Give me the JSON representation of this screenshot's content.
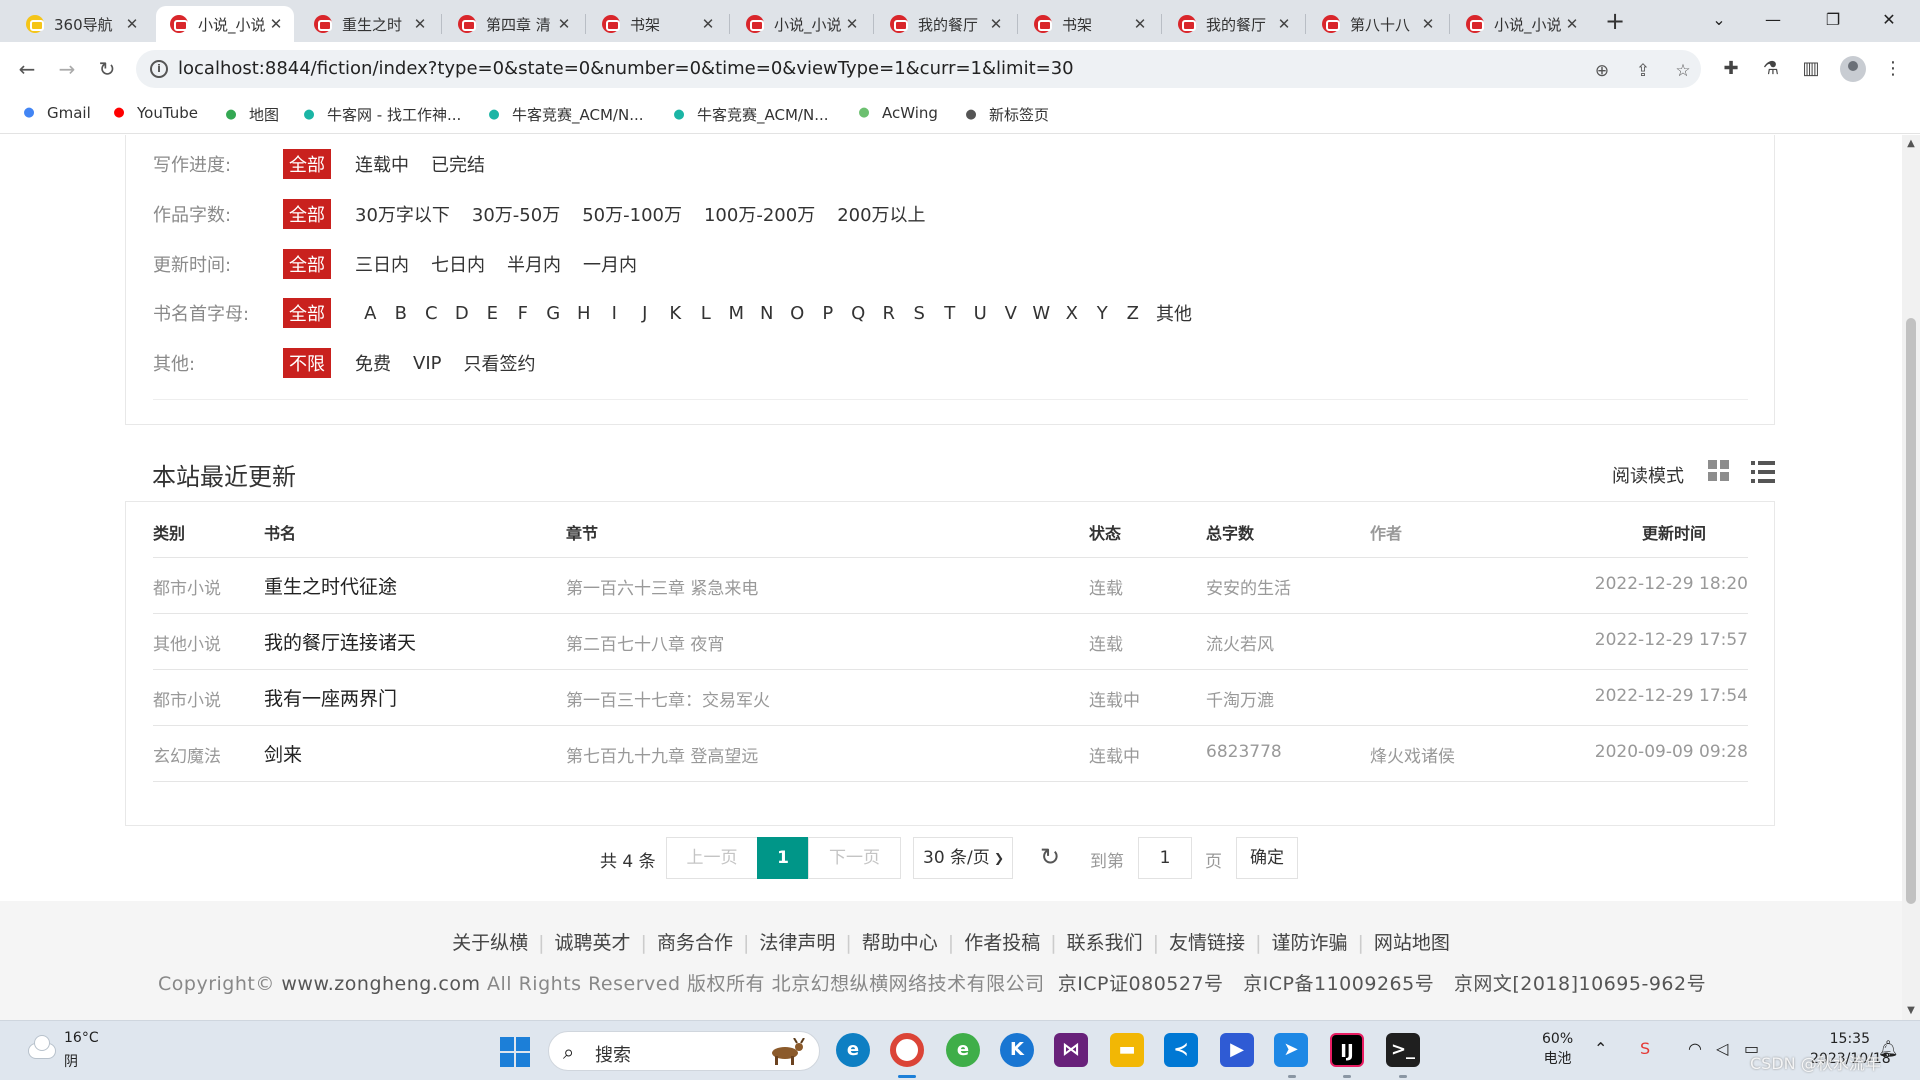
{
  "browser": {
    "tabs": [
      {
        "label": "360导航",
        "icon": "nav-icon"
      },
      {
        "label": "小说_小说",
        "icon": "zongheng-icon",
        "active": true
      },
      {
        "label": "重生之时",
        "icon": "zongheng-icon"
      },
      {
        "label": "第四章 清",
        "icon": "zongheng-icon"
      },
      {
        "label": "书架",
        "icon": "zongheng-icon"
      },
      {
        "label": "小说_小说",
        "icon": "zongheng-icon"
      },
      {
        "label": "我的餐厅",
        "icon": "zongheng-icon"
      },
      {
        "label": "书架",
        "icon": "zongheng-icon"
      },
      {
        "label": "我的餐厅",
        "icon": "zongheng-icon"
      },
      {
        "label": "第八十八",
        "icon": "zongheng-icon"
      },
      {
        "label": "小说_小说",
        "icon": "zongheng-icon"
      }
    ],
    "tab_close": "✕",
    "new_tab": "+",
    "url": "localhost:8844/fiction/index?type=0&state=0&number=0&time=0&viewType=1&curr=1&limit=30",
    "bookmarks": [
      {
        "label": "Gmail",
        "icon": "google-icon",
        "color": "#4285f4"
      },
      {
        "label": "YouTube",
        "icon": "youtube-icon",
        "color": "#ff0000"
      },
      {
        "label": "地图",
        "icon": "maps-icon",
        "color": "#34a853"
      },
      {
        "label": "牛客网 - 找工作神...",
        "icon": "nowcoder-icon",
        "color": "#1bb5a5"
      },
      {
        "label": "牛客竞赛_ACM/N...",
        "icon": "nowcoder-icon",
        "color": "#1bb5a5"
      },
      {
        "label": "牛客竞赛_ACM/N...",
        "icon": "nowcoder-icon",
        "color": "#1bb5a5"
      },
      {
        "label": "AcWing",
        "icon": "acwing-icon",
        "color": "#6cc070"
      },
      {
        "label": "新标签页",
        "icon": "newtab-icon",
        "color": "#555555"
      }
    ]
  },
  "filters": [
    {
      "label": "写作进度:",
      "active": "全部",
      "options": [
        "连载中",
        "已完结"
      ]
    },
    {
      "label": "作品字数:",
      "active": "全部",
      "options": [
        "30万字以下",
        "30万-50万",
        "50万-100万",
        "100万-200万",
        "200万以上"
      ]
    },
    {
      "label": "更新时间:",
      "active": "全部",
      "options": [
        "三日内",
        "七日内",
        "半月内",
        "一月内"
      ]
    },
    {
      "label": "书名首字母:",
      "active": "全部",
      "letters": [
        "A",
        "B",
        "C",
        "D",
        "E",
        "F",
        "G",
        "H",
        "I",
        "J",
        "K",
        "L",
        "M",
        "N",
        "O",
        "P",
        "Q",
        "R",
        "S",
        "T",
        "U",
        "V",
        "W",
        "X",
        "Y",
        "Z"
      ],
      "other": "其他"
    },
    {
      "label": "其他:",
      "active": "不限",
      "options": [
        "免费",
        "VIP",
        "只看签约"
      ]
    }
  ],
  "section": {
    "title": "本站最近更新",
    "read_mode_label": "阅读模式"
  },
  "table": {
    "headers": {
      "category": "类别",
      "book": "书名",
      "chapter": "章节",
      "status": "状态",
      "words": "总字数",
      "author": "作者",
      "updated": "更新时间"
    },
    "rows": [
      {
        "category": "都市小说",
        "book": "重生之时代征途",
        "chapter": "第一百六十三章 紧急来电",
        "status": "连载",
        "words": "安安的生活",
        "author": "",
        "updated": "2022-12-29 18:20"
      },
      {
        "category": "其他小说",
        "book": "我的餐厅连接诸天",
        "chapter": "第二百七十八章 夜宵",
        "status": "连载",
        "words": "流火若风",
        "author": "",
        "updated": "2022-12-29 17:57"
      },
      {
        "category": "都市小说",
        "book": "我有一座两界门",
        "chapter": "第一百三十七章：交易军火",
        "status": "连载中",
        "words": "千淘万漉",
        "author": "",
        "updated": "2022-12-29 17:54"
      },
      {
        "category": "玄幻魔法",
        "book": "剑来",
        "chapter": "第七百九十九章 登高望远",
        "status": "连载中",
        "words": "6823778",
        "author": "烽火戏诸侯",
        "updated": "2020-09-09 09:28"
      }
    ]
  },
  "pager": {
    "total": "共 4 条",
    "prev": "上一页",
    "current": "1",
    "next": "下一页",
    "per_page": "30 条/页",
    "goto_label": "到第",
    "goto_value": "1",
    "page_word": "页",
    "confirm": "确定"
  },
  "footer": {
    "links": [
      "关于纵横",
      "诚聘英才",
      "商务合作",
      "法律声明",
      "帮助中心",
      "作者投稿",
      "联系我们",
      "友情链接",
      "谨防诈骗",
      "网站地图"
    ],
    "copyright_prefix": "Copyright©",
    "copyright_site": "www.zongheng.com",
    "copyright_rest": "All Rights Reserved 版权所有 北京幻想纵横网络技术有限公司",
    "icp": [
      "京ICP证080527号",
      "京ICP备11009265号",
      "京网文[2018]10695-962号"
    ]
  },
  "taskbar": {
    "temperature": "16°C",
    "weather": "阴",
    "search_label": "搜索",
    "battery_pct": "60%",
    "battery_label": "电池",
    "time": "15:35",
    "date": "2023/10/18"
  },
  "watermark": "CSDN @秋水流年",
  "colors": {
    "accent_red": "#c9211e",
    "pager_teal": "#009688"
  }
}
